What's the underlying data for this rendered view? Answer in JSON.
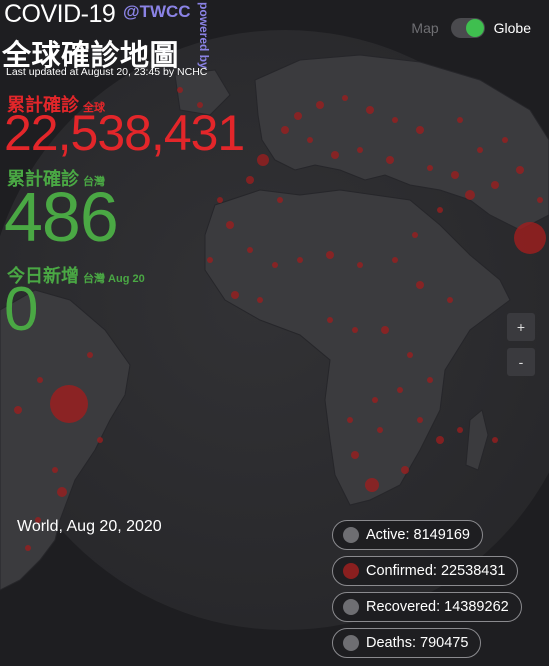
{
  "header": {
    "title": "COVID-19",
    "brand": "@TWCC",
    "powered_by": "powered by",
    "subtitle": "全球確診地圖",
    "last_updated": "Last updated at August 20, 23:45 by NCHC"
  },
  "stats": [
    {
      "label": "累計確診",
      "scope": "全球",
      "value": "22,538,431",
      "color": "#e3262a"
    },
    {
      "label": "累計確診",
      "scope": "台灣",
      "value": "486",
      "color": "#4aa844"
    },
    {
      "label": "今日新增",
      "scope": "台灣 Aug 20",
      "value": "0",
      "color": "#4aa844"
    }
  ],
  "view_toggle": {
    "map_label": "Map",
    "globe_label": "Globe",
    "selected": "Globe"
  },
  "zoom": {
    "in_label": "+",
    "out_label": "-"
  },
  "caption": "World, Aug 20, 2020",
  "legend": [
    {
      "label": "Active: 8149169",
      "color": "#6e6e72"
    },
    {
      "label": "Confirmed: 22538431",
      "color": "#8a1f1f"
    },
    {
      "label": "Recovered: 14389262",
      "color": "#6e6e72"
    },
    {
      "label": "Deaths: 790475",
      "color": "#6e6e72"
    }
  ],
  "colors": {
    "background": "#1e1e21",
    "ocean": "#2d2d30",
    "land": "#3b3b3e",
    "dot": "#a01e1e"
  }
}
